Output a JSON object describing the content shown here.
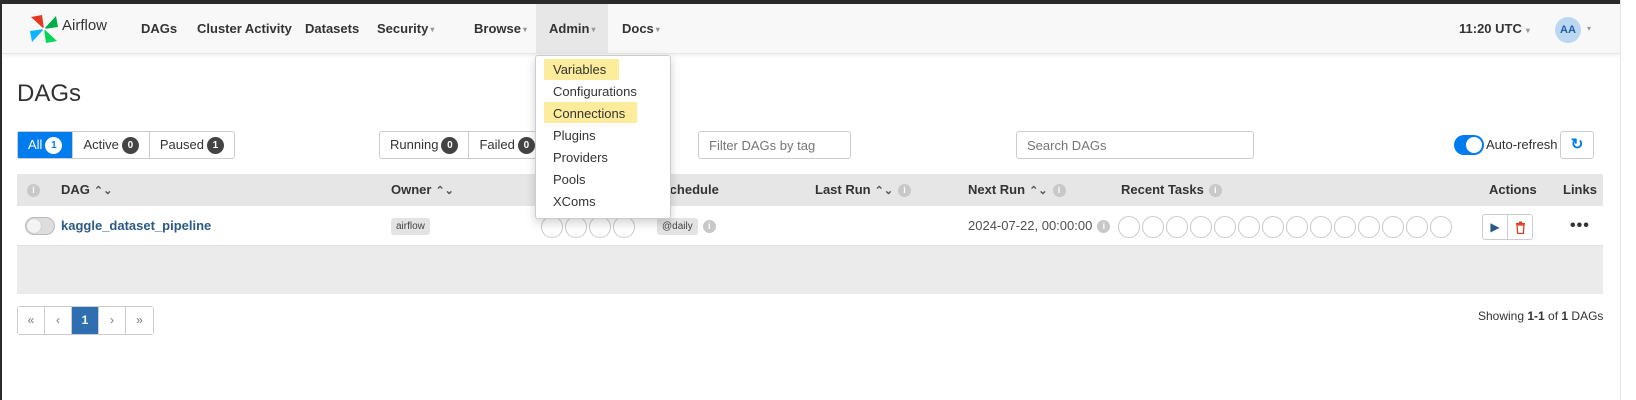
{
  "brand": {
    "name": "Airflow"
  },
  "nav": {
    "items": [
      {
        "label": "DAGs",
        "caret": false
      },
      {
        "label": "Cluster Activity",
        "caret": false
      },
      {
        "label": "Datasets",
        "caret": false
      },
      {
        "label": "Security",
        "caret": true
      },
      {
        "label": "Browse",
        "caret": true
      },
      {
        "label": "Admin",
        "caret": true,
        "active": true
      },
      {
        "label": "Docs",
        "caret": true
      }
    ],
    "time": "11:20 UTC",
    "avatar_initials": "AA"
  },
  "admin_menu": {
    "items": [
      "Variables",
      "Configurations",
      "Connections",
      "Plugins",
      "Providers",
      "Pools",
      "XComs"
    ],
    "highlighted": [
      "Variables",
      "Connections"
    ]
  },
  "page": {
    "title": "DAGs"
  },
  "filters": {
    "all_label": "All",
    "all_count": "1",
    "active_label": "Active",
    "active_count": "0",
    "paused_label": "Paused",
    "paused_count": "1",
    "running_label": "Running",
    "running_count": "0",
    "failed_label": "Failed",
    "failed_count": "0",
    "tag_placeholder": "Filter DAGs by tag",
    "search_placeholder": "Search DAGs",
    "auto_refresh_label": "Auto-refresh",
    "auto_refresh_on": true
  },
  "table": {
    "headers": {
      "dag": "DAG",
      "owner": "Owner",
      "schedule": "Schedule",
      "last_run": "Last Run",
      "next_run": "Next Run",
      "recent_tasks": "Recent Tasks",
      "actions": "Actions",
      "links": "Links"
    },
    "rows": [
      {
        "dag_id": "kaggle_dataset_pipeline",
        "owner": "airflow",
        "runs_circles": 4,
        "schedule": "@daily",
        "last_run": "",
        "next_run": "2024-07-22, 00:00:00",
        "recent_task_circles": 14,
        "paused": true
      }
    ]
  },
  "pagination": {
    "first": "«",
    "prev": "‹",
    "current": "1",
    "next": "›",
    "last": "»",
    "showing_prefix": "Showing ",
    "showing_range": "1-1",
    "showing_of": " of ",
    "showing_total": "1",
    "showing_suffix": " DAGs"
  },
  "colors": {
    "primary": "#017cee",
    "dag_link": "#2c5986",
    "highlight": "#fde98a",
    "delete": "#e43921"
  },
  "icons": {
    "refresh": "refresh-icon",
    "trigger": "play-icon",
    "delete": "trash-icon",
    "links": "more-dots-icon",
    "info": "info-icon",
    "sort": "sort-icon"
  }
}
